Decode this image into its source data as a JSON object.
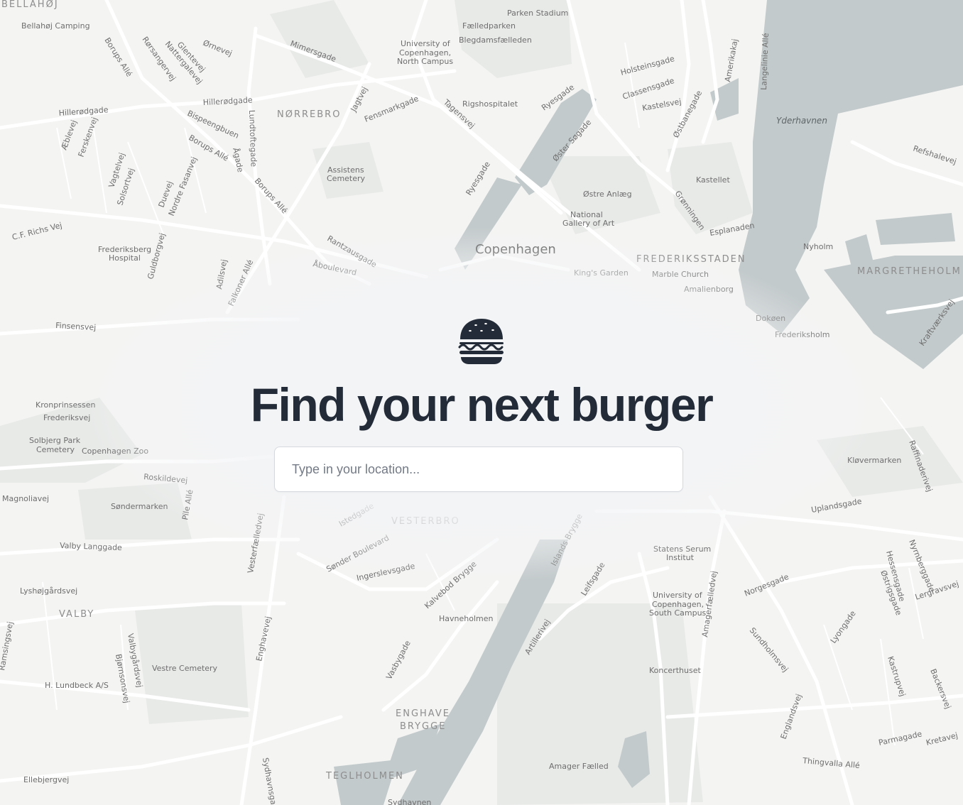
{
  "hero": {
    "icon": "burger-icon",
    "headline": "Find your next burger",
    "search_placeholder": "Type in your location...",
    "search_value": ""
  },
  "map": {
    "city": "Copenhagen",
    "districts": {
      "norrebro": "NØRREBRO",
      "frederiksstaden": "FREDERIKSSTADEN",
      "margretheholm": "MARGRETHEHOLM",
      "vesterbro": "VESTERBRO",
      "valby": "VALBY",
      "enghave_brygge_1": "ENGHAVE",
      "enghave_brygge_2": "BRYGGE",
      "teglholmen": "TEGLHOLMEN",
      "bellahoj": "BELLAHØJ"
    },
    "water": {
      "yderhavnen": "Yderhavnen"
    },
    "places": {
      "parken": "Parken Stadium",
      "faelledparken": "Fælledparken",
      "blegdams": "Blegdamsfælleden",
      "ku_north_1": "University of",
      "ku_north_2": "Copenhagen,",
      "ku_north_3": "North Campus",
      "rigshospitalet": "Rigshospitalet",
      "assistens_1": "Assistens",
      "assistens_2": "Cemetery",
      "bellahoj_camping": "Bellahøj Camping",
      "frb_hosp_1": "Frederiksberg",
      "frb_hosp_2": "Hospital",
      "kastellet": "Kastellet",
      "ostre_anlaeg": "Østre Anlæg",
      "smk_1": "National",
      "smk_2": "Gallery of Art",
      "kings_garden": "King's Garden",
      "marble_church": "Marble Church",
      "amalienborg": "Amalienborg",
      "nyholm": "Nyholm",
      "dokoen": "Dokøen",
      "frederiksholm": "Frederiksholm",
      "kronprinsessen": "Kronprinsessen",
      "frederiksvej": "Frederiksvej",
      "solbjerg_1": "Solbjerg Park",
      "solbjerg_2": "Cemetery",
      "zoo": "Copenhagen Zoo",
      "sondermarken": "Søndermarken",
      "kloevermarken": "Kløvermarken",
      "ssi_1": "Statens Serum",
      "ssi_2": "Institut",
      "ku_south_1": "University of",
      "ku_south_2": "Copenhagen,",
      "ku_south_3": "South Campus",
      "havneholmen": "Havneholmen",
      "koncerthuset": "Koncerthuset",
      "vestre_cemetery": "Vestre Cemetery",
      "lundbeck": "H. Lundbeck A/S",
      "amager_faelled": "Amager Fælled",
      "sydhavnen": "Sydhavnen"
    },
    "streets": {
      "mimersgade": "Mimersgade",
      "hillerodgade_1": "Hillerødgade",
      "hillerodgade_2": "Hillerødgade",
      "bispeengbuen": "Bispeengbuen",
      "borups_alle_1": "Borups Allé",
      "borups_alle_2": "Borups Allé",
      "borups_alle_3": "Borups Allé",
      "lundtoftegade": "Lundtoftegade",
      "aagade": "Ågade",
      "jagtvej": "Jagtvej",
      "fensmarkgade": "Fensmarkgade",
      "tagensvej_1": "Tagensvej",
      "tagensvej_2": "Tagensvej",
      "ryesgade_1": "Ryesgade",
      "ryesgade_2": "Ryesgade",
      "oster_sogade": "Øster Søgade",
      "rantzausgade": "Rantzausgade",
      "aboulevard": "Åboulevard",
      "holsteinsgade": "Holsteinsgade",
      "classensgade": "Classensgade",
      "kastelsvej": "Kastelsvej",
      "ostbanegade": "Østbanegade",
      "gronningen": "Grønningen",
      "esplanaden": "Esplanaden",
      "amerikakaj": "Amerikakaj",
      "langelinie": "Langelinie Allé",
      "refshalevej": "Refshalevej",
      "kraftvaerksvej": "Kraftværksvej",
      "raffinaderivej": "Raffinaderivej",
      "uplandsgade": "Uplandsgade",
      "ornevej": "Ørnevej",
      "glentevej": "Glentevej",
      "nattergalevej": "Nattergalevej",
      "rorsangervej": "Rørsangervej",
      "aeblevej": "Æblevej",
      "ferskenvej": "Ferskenvej",
      "vagtelvej": "Vagtelvej",
      "solsortvej": "Solsortvej",
      "duevej": "Duevej",
      "nordre_fasanvej": "Nordre Fasanvej",
      "guldborgvej": "Guldborgvej",
      "cf_richs_vej": "C.F. Richs Vej",
      "finsensvej": "Finsensvej",
      "falkoner_alle": "Falkoner Allé",
      "adilsvej": "Adilsvej",
      "roskildevej": "Roskildevej",
      "pile_alle": "Pile Allé",
      "valby_langgade": "Valby Langgade",
      "lyshojgardsvej": "Lyshøjgårdsvej",
      "vesterfaelledvej": "Vesterfælledvej",
      "sonder_boulevard": "Sønder Boulevard",
      "ingerslevsgade": "Ingerslevsgade",
      "istedgade": "Istedgade",
      "kalvebod_brygge": "Kalvebod Brygge",
      "islands_brygge": "Islands Brygge",
      "lefsgade": "Leifsgade",
      "artillerivej": "Artillerivej",
      "amagerfaelledvej": "Amagerfælledvej",
      "norgesgade": "Norgesgade",
      "sundholmsvej": "Sundholmsvej",
      "hessensgade": "Hessensgade",
      "nyrnberggade": "Nyrnberggade",
      "ostrigsgade": "Østrigsgade",
      "lergravsvej": "Lergravsvej",
      "lyongade": "Lyongade",
      "kastrupvej": "Kastrupvej",
      "backersvej": "Backersvej",
      "englandsvej": "Englandsvej",
      "parmagade": "Parmagade",
      "kretavej": "Kretavej",
      "thingvalla": "Thingvalla Allé",
      "vasbygade": "Vasbygade",
      "enghavevej": "Enghavevej",
      "valbygardsvej": "Valbygårdsvej",
      "bjernsonsvej": "Bjørnsonsvej",
      "sydhavnsgade": "Sydhavnsgade",
      "ellebjergvej": "Ellebjergvej",
      "magnoliavej": "Magnoliavej",
      "ramsingsvej": "Ramsingsvej"
    }
  },
  "colors": {
    "headline": "#232b38",
    "water": "#c3cacb",
    "land": "#f4f4f3",
    "road": "#ffffff",
    "park": "#e9ecea"
  }
}
